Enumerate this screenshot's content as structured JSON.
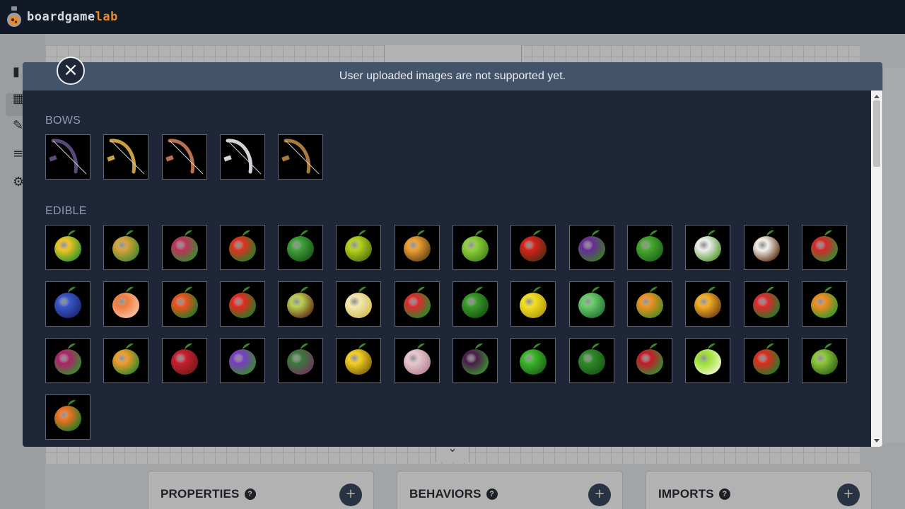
{
  "app": {
    "logo_part1": "boardgame",
    "logo_part2": "lab"
  },
  "panels": [
    {
      "title": "PROPERTIES",
      "add": "+"
    },
    {
      "title": "BEHAVIORS",
      "add": "+"
    },
    {
      "title": "IMPORTS",
      "add": "+"
    }
  ],
  "modal": {
    "notice": "User uploaded images are not supported yet.",
    "close": "×",
    "sections": [
      {
        "title": "BOWS",
        "items": [
          "bow-purple-icon",
          "bow-gold-icon",
          "bow-copper-icon",
          "bow-silver-icon",
          "bow-bronze-icon"
        ]
      },
      {
        "title": "EDIBLE",
        "items": [
          "corn-icon",
          "pineapple-icon",
          "radish-icon",
          "chili-pepper-icon",
          "watermelon-icon",
          "yellow-apple-icon",
          "pear-icon",
          "green-apple-icon",
          "red-apple-icon",
          "plum-icon",
          "peas-icon",
          "daikon-icon",
          "coconut-icon",
          "cranberry-icon",
          "blueberry-icon",
          "grapefruit-icon",
          "tangerine-icon",
          "tomato-icon",
          "avocado-icon",
          "star-fruit-icon",
          "strawberry-icon",
          "cucumber-icon",
          "lemon-icon",
          "cabbage-icon",
          "persimmon-icon",
          "yellow-cherry-icon",
          "redcurrant-icon",
          "carrot-icon",
          "beet-icon",
          "peach-icon",
          "pomegranate-icon",
          "grapes-purple-icon",
          "basil-icon",
          "banana-icon",
          "garlic-icon",
          "grapes-dark-icon",
          "green-pepper-icon",
          "broccoli-icon",
          "cherry-icon",
          "lime-icon",
          "red-pepper-icon",
          "green-grapes-icon",
          "orange-strawberry-icon"
        ]
      }
    ]
  },
  "colors": {
    "topbar": "#111826",
    "modal_bg": "#1e2637",
    "modal_header": "#43536a",
    "section_title": "#8d9cb5",
    "logo_accent": "#e98a2a"
  }
}
